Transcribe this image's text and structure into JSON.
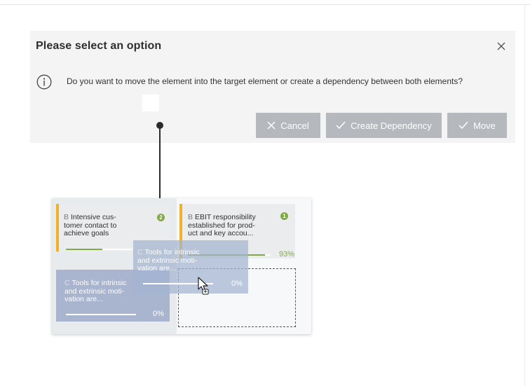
{
  "dialog": {
    "title": "Please select an option",
    "message": "Do you want to move the element into the target element or create a dependency between both elements?",
    "buttons": {
      "cancel": "Cancel",
      "create_dependency": "Create Dependency",
      "move": "Move"
    }
  },
  "board": {
    "cards": [
      {
        "letter": "B",
        "text": "Intensive cus-\ntomer contact to\nachieve goals",
        "badge": "2",
        "progress": 0.55,
        "percent": ""
      },
      {
        "letter": "B",
        "text": "EBIT responsibility\nestablished for prod-\nuct and key accou...",
        "badge": "1",
        "progress": 0.93,
        "percent": "93%"
      },
      {
        "letter": "C",
        "text": "Tools for intrinsic\nand extrinsic moti-\nvation are...",
        "badge": "",
        "progress": 0,
        "percent": "0%"
      }
    ],
    "drag_ghost": {
      "letter": "C",
      "text": "Tools for intrinsic\nand extrinsic moti-\nvation are...",
      "percent": "0%"
    }
  },
  "colors": {
    "dialog_bg": "#f4f4f4",
    "button_bg": "#b5b9bd",
    "accent_orange": "#f2b12a",
    "progress_green": "#7faa45",
    "card_blue": "#a9b5cf"
  },
  "icons": [
    "close-icon",
    "info-icon",
    "cancel-x-icon",
    "checkmark-icon",
    "cursor-icon"
  ]
}
